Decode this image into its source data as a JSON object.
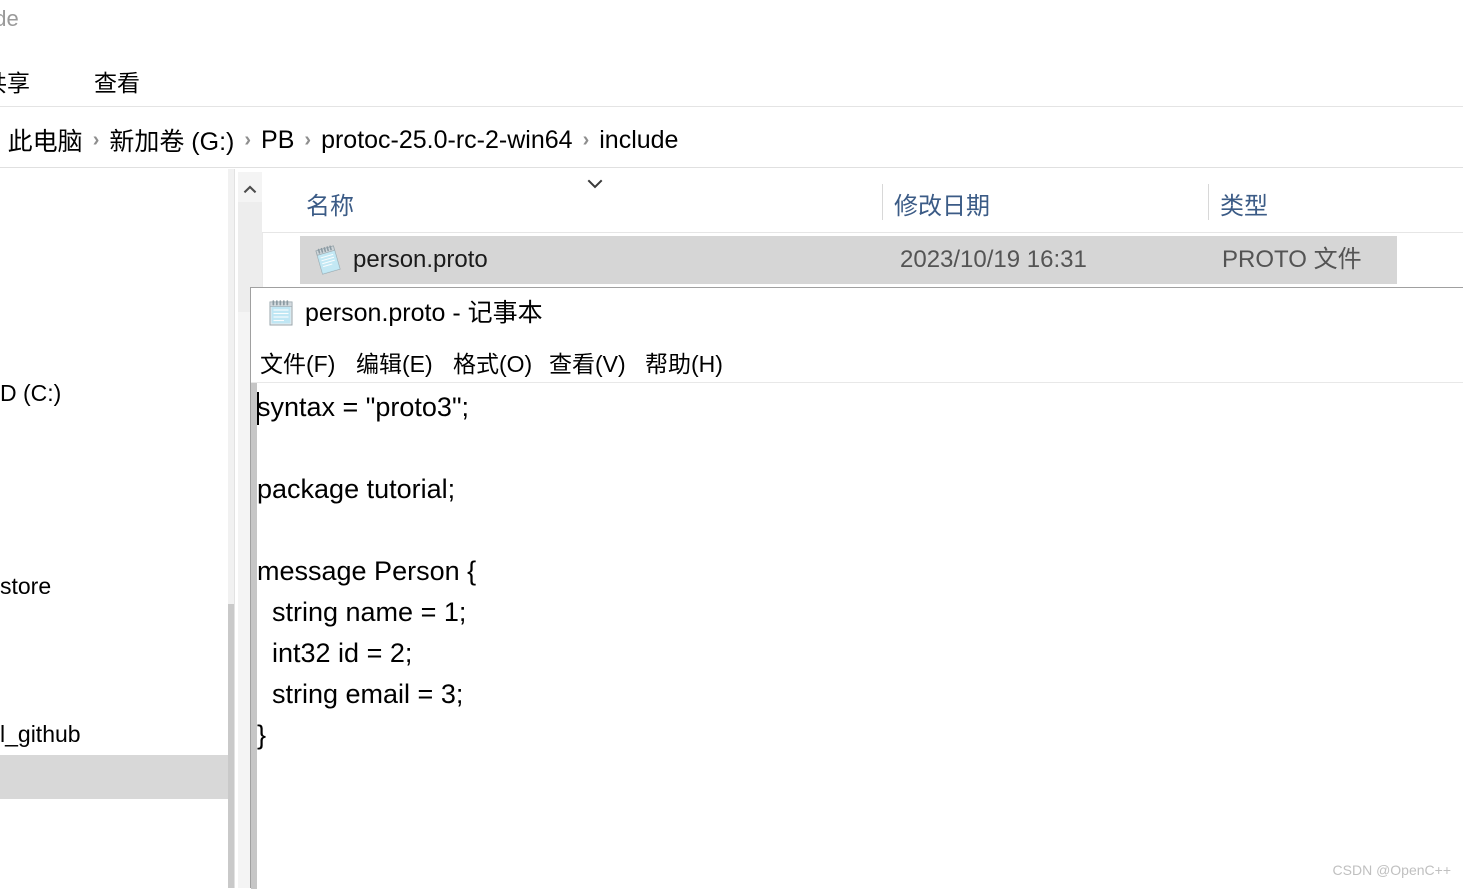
{
  "explorer": {
    "window_title": "ude",
    "ribbon_tabs": [
      {
        "label": "共享"
      },
      {
        "label": "查看"
      }
    ],
    "breadcrumb": {
      "separator": "›",
      "items": [
        {
          "label": "此电脑"
        },
        {
          "label": "新加卷 (G:)"
        },
        {
          "label": "PB"
        },
        {
          "label": "protoc-25.0-rc-2-win64"
        },
        {
          "label": "include"
        }
      ]
    },
    "nav_pane": {
      "items": [
        {
          "label": "D (C:)",
          "selected": false
        },
        {
          "label": "store",
          "selected": false
        },
        {
          "label": "l_github",
          "selected": false
        },
        {
          "label": "",
          "selected": true
        }
      ]
    },
    "file_list": {
      "columns": [
        {
          "label": "名称"
        },
        {
          "label": "修改日期"
        },
        {
          "label": "类型"
        }
      ],
      "sort_indicator": "⌄",
      "scroll_up_arrow": "⌃",
      "rows": [
        {
          "icon": "proto-file-icon",
          "name": "person.proto",
          "modified": "2023/10/19 16:31",
          "type": "PROTO 文件",
          "selected": true
        }
      ]
    }
  },
  "notepad": {
    "title": "person.proto - 记事本",
    "icon": "notepad-icon",
    "menu": [
      {
        "label": "文件(F)"
      },
      {
        "label": "编辑(E)"
      },
      {
        "label": "格式(O)"
      },
      {
        "label": "查看(V)"
      },
      {
        "label": "帮助(H)"
      }
    ],
    "content": "syntax = \"proto3\";\n\npackage tutorial;\n\nmessage Person {\n  string name = 1;\n  int32 id = 2;\n  string email = 3;\n}"
  },
  "watermark": {
    "text": "CSDN @OpenC++"
  },
  "colors": {
    "selection_grey": "#d6d6d6",
    "column_header_blue": "#3b5b86",
    "window_border": "#a0a0a0",
    "watermark_grey": "#c0c0c0"
  }
}
